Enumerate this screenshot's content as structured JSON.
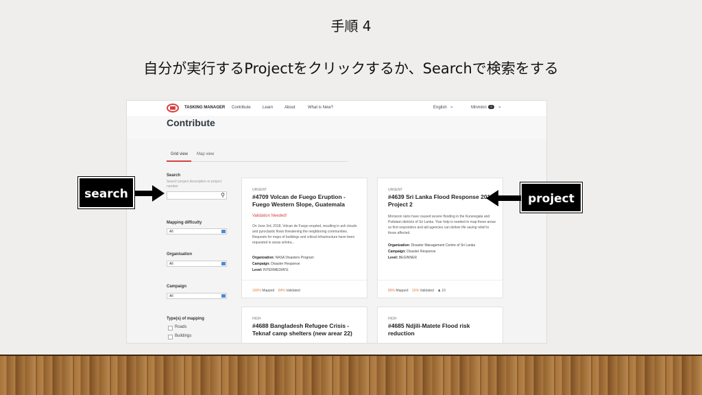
{
  "slide": {
    "title": "手順 4",
    "subtitle": "自分が実行するProjectをクリックするか、Searchで検索をする"
  },
  "callouts": {
    "search": "search",
    "project": "project"
  },
  "app": {
    "brand": "TASKING MANAGER",
    "nav": [
      "Contribute",
      "Learn",
      "About",
      "What is New?"
    ],
    "language": "English",
    "user": "Minminn",
    "user_badge": "3",
    "page_title": "Contribute",
    "tabs": [
      "Grid view",
      "Map view"
    ]
  },
  "sidebar": {
    "search_label": "Search",
    "search_placeholder": "Search project description or project number",
    "filters": [
      {
        "label": "Mapping difficulty",
        "value": "All"
      },
      {
        "label": "Organisation",
        "value": "All"
      },
      {
        "label": "Campaign",
        "value": "All"
      }
    ],
    "mapping_types_label": "Type(s) of mapping",
    "mapping_types": [
      "Roads",
      "Buildings"
    ]
  },
  "projects": [
    {
      "priority": "URGENT",
      "title": "#4709 Volcan de Fuego Eruption - Fuego Western Slope, Guatemala",
      "status": "Validation Needed!",
      "description": "On June 3rd, 2018, Volcan de Fuego erupted, resulting in ash clouds and pyroclastic flows threatening the neighboring communities. Requests for maps of buildings and critical infrastructure have been requested in areas w/intra...",
      "organization": "NASA Disasters Program",
      "campaign": "Disaster Response",
      "level": "INTERMEDIATE",
      "mapped": "100%",
      "mapped_label": "Mapped",
      "validated": "84%",
      "validated_label": "Validated"
    },
    {
      "priority": "URGENT",
      "title": "#4639 Sri Lanka Flood Response 2018 Project 2",
      "description": "Monsoon rains have caused severe flooding in the Kurunegala and Puttalam districts of Sri Lanka. Your help is needed to map these areas so first responders and aid agencies can deliver life saving relief to those affected.",
      "organization": "Disaster Management Centre of Sri Lanka",
      "campaign": "Disaster Response",
      "level": "BEGINNER",
      "mapped": "89%",
      "mapped_label": "Mapped",
      "validated": "16%",
      "validated_label": "Validated",
      "contributors": "10"
    },
    {
      "priority": "HIGH",
      "title": "#4688 Bangladesh Refugee Crisis - Teknaf camp shelters (new arear 22)"
    },
    {
      "priority": "HIGH",
      "title": "#4685 Ndjili-Matete Flood risk reduction"
    }
  ],
  "labels": {
    "organization": "Organization:",
    "campaign": "Campaign:",
    "level": "Level:"
  }
}
